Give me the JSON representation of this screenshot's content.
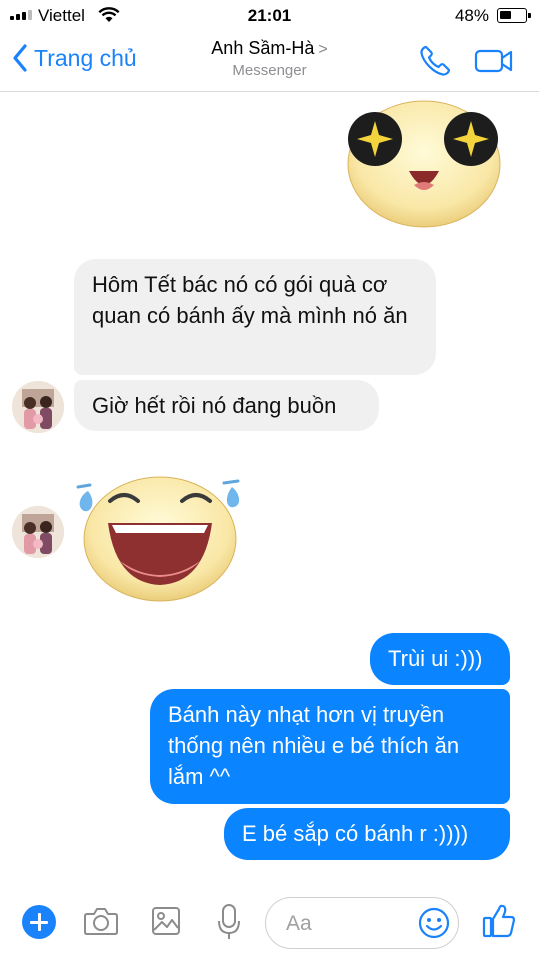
{
  "status": {
    "carrier": "Viettel",
    "time": "21:01",
    "battery_percent_text": "48%",
    "battery_level": 0.48
  },
  "header": {
    "back_label": "Trang chủ",
    "title": "Anh Sầm-Hà",
    "title_chevron": ">",
    "subtitle": "Messenger"
  },
  "messages": {
    "m1_sticker": "star-eyes-sticker",
    "m2": "Hôm Tết bác nó có gói quà cơ quan có bánh ấy mà mình nó ăn",
    "m3": "Giờ hết rồi nó đang buồn",
    "m4_sticker": "laughing-tears-sticker",
    "m5": "Trùi ui :)))",
    "m6": "Bánh này nhạt hơn vị truyền thống nên nhiều e bé thích ăn lắm ^^",
    "m7": "E bé sắp có bánh r :))))"
  },
  "composer": {
    "placeholder": "Aa",
    "icons": [
      "plus-icon",
      "camera-icon",
      "gallery-icon",
      "mic-icon",
      "emoji-icon",
      "like-icon"
    ]
  },
  "colors": {
    "accent": "#1a82fb",
    "outgoing_bubble": "#0a84ff",
    "incoming_bubble": "#f1f0f0"
  }
}
